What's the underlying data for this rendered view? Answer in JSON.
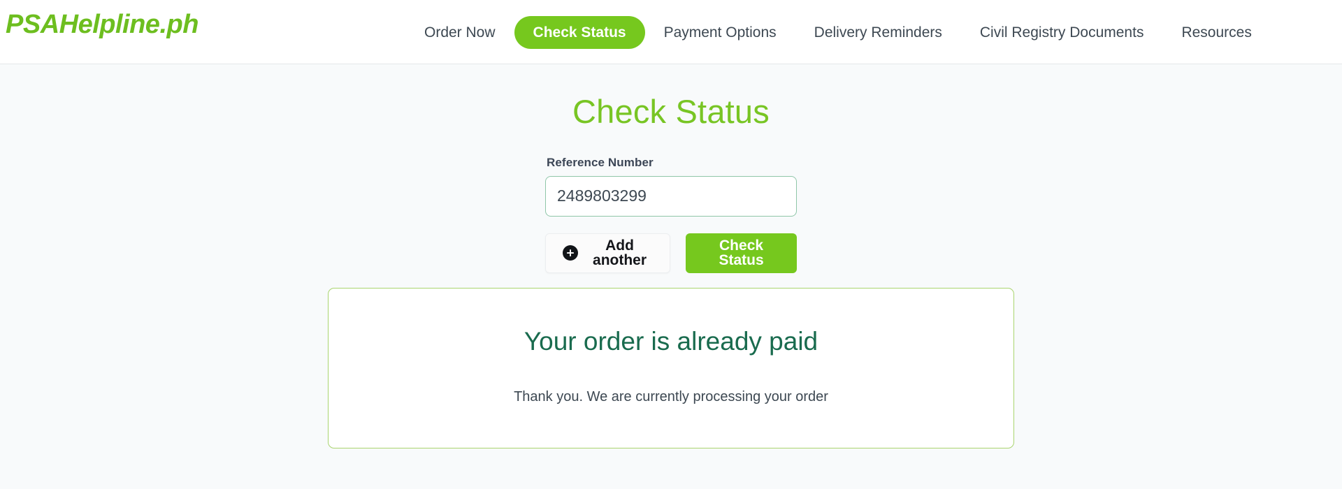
{
  "header": {
    "brand": "PSAHelpline.ph",
    "nav": [
      {
        "label": "Order Now",
        "active": false
      },
      {
        "label": "Check Status",
        "active": true
      },
      {
        "label": "Payment Options",
        "active": false
      },
      {
        "label": "Delivery Reminders",
        "active": false
      },
      {
        "label": "Civil Registry Documents",
        "active": false
      },
      {
        "label": "Resources",
        "active": false
      }
    ]
  },
  "main": {
    "title": "Check Status",
    "form": {
      "reference_label": "Reference Number",
      "reference_value": "2489803299",
      "reference_placeholder": "",
      "add_another_label": "Add another",
      "add_another_icon": "plus-circle-icon",
      "submit_label": "Check Status"
    },
    "result": {
      "title": "Your order is already paid",
      "subtitle": "Thank you. We are currently processing your order"
    }
  },
  "colors": {
    "brand_green": "#6dbe1f",
    "accent_green": "#76c81e",
    "title_green": "#78c524",
    "result_green": "#196b4e",
    "result_border": "#a9d46f",
    "input_border": "#8fc6a8",
    "page_bg": "#f8fafb",
    "nav_text": "#3d4852"
  }
}
